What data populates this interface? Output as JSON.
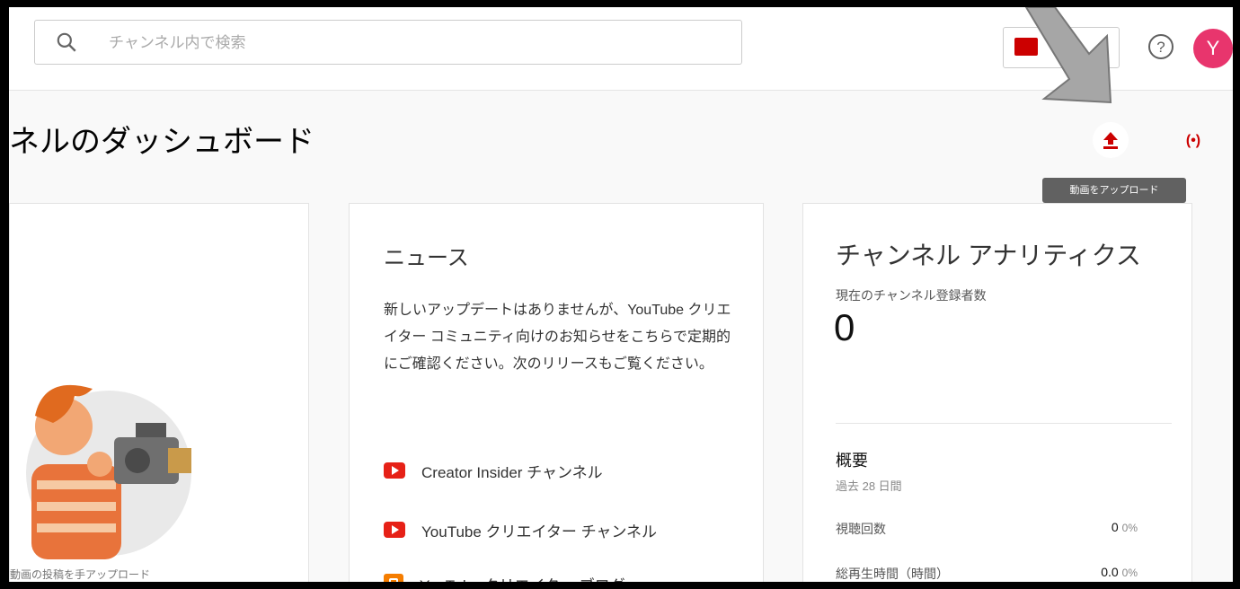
{
  "search": {
    "placeholder": "チャンネル内で検索"
  },
  "header": {
    "avatar_initial": "Y"
  },
  "page": {
    "title": "ネルのダッシュボード"
  },
  "tooltip": {
    "upload": "動画をアップロード"
  },
  "live": {
    "label": "(•)"
  },
  "left_card": {
    "caption": "動画の投稿を手アップロード"
  },
  "news": {
    "title": "ニュース",
    "body": "新しいアップデートはありませんが、YouTube クリエイター コミュニティ向けのお知らせをこちらで定期的にご確認ください。次のリリースもご覧ください。",
    "links": [
      {
        "label": "Creator Insider チャンネル",
        "icon": "youtube-icon"
      },
      {
        "label": "YouTube クリエイター チャンネル",
        "icon": "youtube-icon"
      },
      {
        "label": "YouTube クリエイター ブログ",
        "icon": "blogger-icon"
      }
    ]
  },
  "analytics": {
    "title": "チャンネル アナリティクス",
    "subs_label": "現在のチャンネル登録者数",
    "subs_count": "0",
    "summary_title": "概要",
    "summary_period": "過去 28 日間",
    "metrics": [
      {
        "label": "視聴回数",
        "value": "0",
        "pct": "0%"
      },
      {
        "label": "総再生時間（時間）",
        "value": "0.0",
        "pct": "0%"
      }
    ]
  },
  "colors": {
    "accent": "#cc0000",
    "avatar": "#e8356d",
    "tooltip": "#616161"
  }
}
